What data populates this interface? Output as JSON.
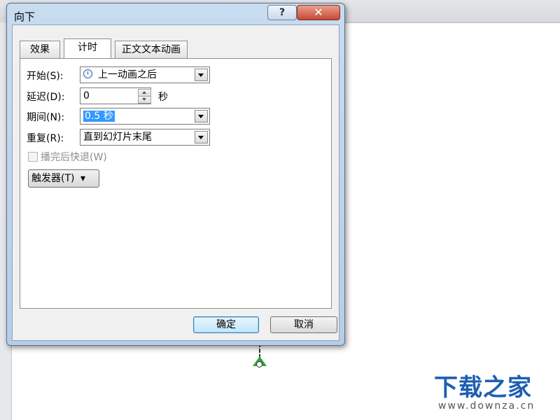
{
  "dialog": {
    "title": "向下",
    "help_label": "?",
    "close_label": "✕",
    "tabs": [
      {
        "label": "效果",
        "active": false
      },
      {
        "label": "计时",
        "active": true
      },
      {
        "label": "正文文本动画",
        "active": false
      }
    ],
    "timing": {
      "start_label": "开始(S):",
      "start_value": "上一动画之后",
      "start_icon": "clock-icon",
      "delay_label": "延迟(D):",
      "delay_value": "0",
      "delay_unit": "秒",
      "duration_label": "期间(N):",
      "duration_value": "0.5 秒",
      "repeat_label": "重复(R):",
      "repeat_value": "直到幻灯片末尾",
      "rewind_label": "播完后快退(W)",
      "rewind_checked": false,
      "trigger_label": "触发器(T)",
      "trigger_icon": "double-chevron-down-icon"
    },
    "buttons": {
      "ok_label": "确定",
      "cancel_label": "取消"
    }
  },
  "watermark": {
    "logo": "下载之家",
    "url": "www.downza.cn"
  },
  "colors": {
    "accent": "#1c5fb2",
    "selection": "#3399ff",
    "motion_arrow": "#2aa33b"
  }
}
